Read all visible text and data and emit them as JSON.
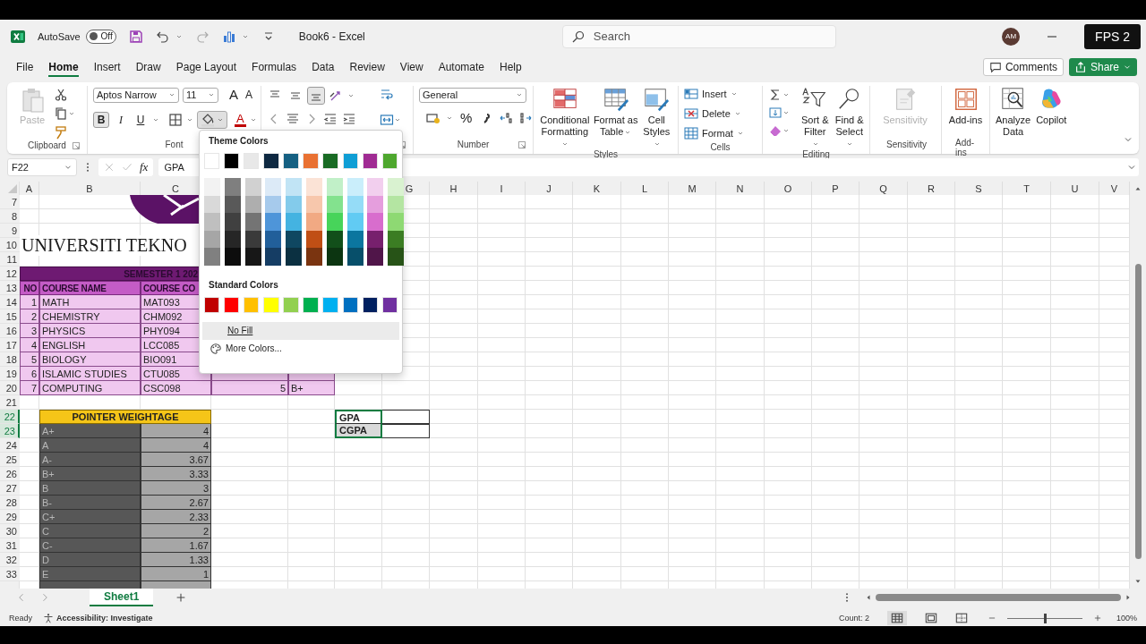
{
  "title_bar": {
    "autosave_label": "AutoSave",
    "autosave_on": false,
    "autosave_state": "Off",
    "document_title": "Book6  -  Excel",
    "search_placeholder": "Search",
    "avatar_initials": "AM",
    "overlay_badge": "FPS 2"
  },
  "menu_tabs": [
    {
      "label": "File",
      "selected": false
    },
    {
      "label": "Home",
      "selected": true
    },
    {
      "label": "Insert",
      "selected": false
    },
    {
      "label": "Draw",
      "selected": false
    },
    {
      "label": "Page Layout",
      "selected": false
    },
    {
      "label": "Formulas",
      "selected": false
    },
    {
      "label": "Data",
      "selected": false
    },
    {
      "label": "Review",
      "selected": false
    },
    {
      "label": "View",
      "selected": false
    },
    {
      "label": "Automate",
      "selected": false
    },
    {
      "label": "Help",
      "selected": false
    }
  ],
  "header_buttons": {
    "comments": "Comments",
    "share": "Share"
  },
  "ribbon": {
    "clipboard": {
      "label": "Clipboard",
      "paste_label": "Paste",
      "paste_disabled": true
    },
    "font": {
      "label": "Font",
      "font_name": "Aptos Narrow",
      "font_size": "11",
      "grow_label": "A",
      "shrink_label": "A",
      "styles": [
        {
          "label": "B",
          "selected": true
        },
        {
          "label": "I",
          "selected": false
        },
        {
          "label": "U",
          "selected": false
        }
      ],
      "fill_expanded": true,
      "font_color_label": "A"
    },
    "alignment": {
      "vertical": [
        {
          "selected": false
        },
        {
          "selected": false
        },
        {
          "selected": true
        }
      ]
    },
    "number": {
      "label": "Number",
      "format": "General",
      "percent_label": "%"
    },
    "styles": {
      "label": "Styles",
      "buttons": [
        {
          "kind": "conditional",
          "label": "Conditional Formatting"
        },
        {
          "kind": "table",
          "label": "Format as Table"
        },
        {
          "kind": "cellstyles",
          "label": "Cell Styles"
        }
      ]
    },
    "cells": {
      "label": "Cells",
      "buttons": [
        {
          "kind": "insert",
          "label": "Insert"
        },
        {
          "kind": "delete",
          "label": "Delete"
        },
        {
          "kind": "format",
          "label": "Format"
        }
      ]
    },
    "editing": {
      "label": "Editing",
      "buttons": [
        {
          "kind": "sort",
          "label": "Sort & Filter"
        },
        {
          "kind": "find",
          "label": "Find & Select"
        }
      ]
    },
    "sensitivity": {
      "label": "Sensitivity",
      "button_label": "Sensitivity",
      "disabled": true
    },
    "addins": {
      "label": "Add-ins",
      "button_label": "Add-ins"
    },
    "ai_buttons": [
      {
        "kind": "analyze",
        "label": "Analyze Data"
      },
      {
        "kind": "copilot",
        "label": "Copilot"
      }
    ]
  },
  "formula_bar": {
    "name_box": "F22",
    "fx_label": "fx",
    "formula": "GPA"
  },
  "fill_menu": {
    "theme_title": "Theme Colors",
    "theme_colors": [
      {
        "color": "#ffffff",
        "shades": [
          {
            "color": "#f2f2f2"
          },
          {
            "color": "#d9d9d9"
          },
          {
            "color": "#bfbfbf"
          },
          {
            "color": "#a6a6a6"
          },
          {
            "color": "#808080"
          }
        ]
      },
      {
        "color": "#000000",
        "shades": [
          {
            "color": "#7f7f7f"
          },
          {
            "color": "#595959"
          },
          {
            "color": "#404040"
          },
          {
            "color": "#262626"
          },
          {
            "color": "#0d0d0d"
          }
        ]
      },
      {
        "color": "#e8e8e8",
        "shades": [
          {
            "color": "#d1d1d1"
          },
          {
            "color": "#aeaeae"
          },
          {
            "color": "#747474"
          },
          {
            "color": "#3a3a3a"
          },
          {
            "color": "#171717"
          }
        ]
      },
      {
        "color": "#0e2841",
        "shades": [
          {
            "color": "#dceaf7"
          },
          {
            "color": "#a6caec"
          },
          {
            "color": "#4e95d9"
          },
          {
            "color": "#215f9a"
          },
          {
            "color": "#153d64"
          }
        ]
      },
      {
        "color": "#156082",
        "shades": [
          {
            "color": "#c1e4f5"
          },
          {
            "color": "#83cbeb"
          },
          {
            "color": "#44b3e1"
          },
          {
            "color": "#0f4761"
          },
          {
            "color": "#0b3041"
          }
        ]
      },
      {
        "color": "#e97132",
        "shades": [
          {
            "color": "#fbe3d6"
          },
          {
            "color": "#f7c7ac"
          },
          {
            "color": "#f1a983"
          },
          {
            "color": "#c04f15"
          },
          {
            "color": "#7a3410"
          }
        ]
      },
      {
        "color": "#196b24",
        "shades": [
          {
            "color": "#c1f0c8"
          },
          {
            "color": "#83e28e"
          },
          {
            "color": "#47d45a"
          },
          {
            "color": "#124f1a"
          },
          {
            "color": "#0c3511"
          }
        ]
      },
      {
        "color": "#0f9ed5",
        "shades": [
          {
            "color": "#caeefb"
          },
          {
            "color": "#95dcf7"
          },
          {
            "color": "#61cbf3"
          },
          {
            "color": "#0b769f"
          },
          {
            "color": "#074f6a"
          }
        ]
      },
      {
        "color": "#a02b93",
        "shades": [
          {
            "color": "#f2cfee"
          },
          {
            "color": "#e59edd"
          },
          {
            "color": "#d86dcd"
          },
          {
            "color": "#77206d"
          },
          {
            "color": "#501549"
          }
        ]
      },
      {
        "color": "#4ea72e",
        "shades": [
          {
            "color": "#d9f2d0"
          },
          {
            "color": "#b4e5a2"
          },
          {
            "color": "#8ed973"
          },
          {
            "color": "#3b7d23"
          },
          {
            "color": "#275317"
          }
        ]
      }
    ],
    "standard_title": "Standard Colors",
    "standard_colors": [
      {
        "color": "#c00000"
      },
      {
        "color": "#ff0000"
      },
      {
        "color": "#ffc000"
      },
      {
        "color": "#ffff00"
      },
      {
        "color": "#92d050"
      },
      {
        "color": "#00b050"
      },
      {
        "color": "#00b0f0"
      },
      {
        "color": "#0070c0"
      },
      {
        "color": "#002060"
      },
      {
        "color": "#7030a0"
      }
    ],
    "no_fill": "No Fill",
    "more_colors": "More Colors..."
  },
  "sheet": {
    "column_headers": [
      "A",
      "B",
      "C",
      "G",
      "H",
      "I",
      "J",
      "K",
      "L",
      "M",
      "N",
      "O",
      "P",
      "Q",
      "R",
      "S",
      "T",
      "U",
      "V"
    ],
    "row_headers": [
      {
        "label": "7",
        "selected": false
      },
      {
        "label": "8",
        "selected": false
      },
      {
        "label": "9",
        "selected": false
      },
      {
        "label": "10",
        "selected": false
      },
      {
        "label": "11",
        "selected": false
      },
      {
        "label": "12",
        "selected": false
      },
      {
        "label": "13",
        "selected": false
      },
      {
        "label": "14",
        "selected": false
      },
      {
        "label": "15",
        "selected": false
      },
      {
        "label": "16",
        "selected": false
      },
      {
        "label": "17",
        "selected": false
      },
      {
        "label": "18",
        "selected": false
      },
      {
        "label": "19",
        "selected": false
      },
      {
        "label": "20",
        "selected": false
      },
      {
        "label": "21",
        "selected": false
      },
      {
        "label": "22",
        "selected": true
      },
      {
        "label": "23",
        "selected": true
      },
      {
        "label": "24",
        "selected": false
      },
      {
        "label": "25",
        "selected": false
      },
      {
        "label": "26",
        "selected": false
      },
      {
        "label": "27",
        "selected": false
      },
      {
        "label": "28",
        "selected": false
      },
      {
        "label": "29",
        "selected": false
      },
      {
        "label": "30",
        "selected": false
      },
      {
        "label": "31",
        "selected": false
      },
      {
        "label": "32",
        "selected": false
      },
      {
        "label": "33",
        "selected": false
      }
    ],
    "university_name": "UNIVERSITI TEKNO",
    "course_table": {
      "title": "SEMESTER 1 202",
      "columns": [
        "NO",
        "COURSE NAME",
        "COURSE CO"
      ],
      "rows": [
        {
          "no": "1",
          "name": "MATH",
          "code": "MAT093"
        },
        {
          "no": "2",
          "name": "CHEMISTRY",
          "code": "CHM092"
        },
        {
          "no": "3",
          "name": "PHYSICS",
          "code": "PHY094"
        },
        {
          "no": "4",
          "name": "ENGLISH",
          "code": "LCC085"
        },
        {
          "no": "5",
          "name": "BIOLOGY",
          "code": "BIO091"
        },
        {
          "no": "6",
          "name": "ISLAMIC STUDIES",
          "code": "CTU085"
        },
        {
          "no": "7",
          "name": "COMPUTING",
          "code": "CSC098",
          "credit": "5",
          "grade": "B+"
        }
      ]
    },
    "pointer_table": {
      "title": "POINTER WEIGHTAGE",
      "rows": [
        {
          "grade": "A+",
          "pointer": "4"
        },
        {
          "grade": "A",
          "pointer": "4"
        },
        {
          "grade": "A-",
          "pointer": "3.67"
        },
        {
          "grade": "B+",
          "pointer": "3.33"
        },
        {
          "grade": "B",
          "pointer": "3"
        },
        {
          "grade": "B-",
          "pointer": "2.67"
        },
        {
          "grade": "C+",
          "pointer": "2.33"
        },
        {
          "grade": "C",
          "pointer": "2"
        },
        {
          "grade": "C-",
          "pointer": "1.67"
        },
        {
          "grade": "D",
          "pointer": "1.33"
        },
        {
          "grade": "E",
          "pointer": "1"
        }
      ]
    },
    "gpa_cells": [
      {
        "label": "GPA",
        "active": true
      },
      {
        "label": "CGPA",
        "active": false
      }
    ]
  },
  "sheet_tabs": [
    {
      "label": "Sheet1",
      "selected": true
    }
  ],
  "status_bar": {
    "mode": "Ready",
    "accessibility": "Accessibility: Investigate",
    "count": "Count: 2",
    "zoom": "100%",
    "zoom_slider": {
      "level": 0.5
    }
  }
}
